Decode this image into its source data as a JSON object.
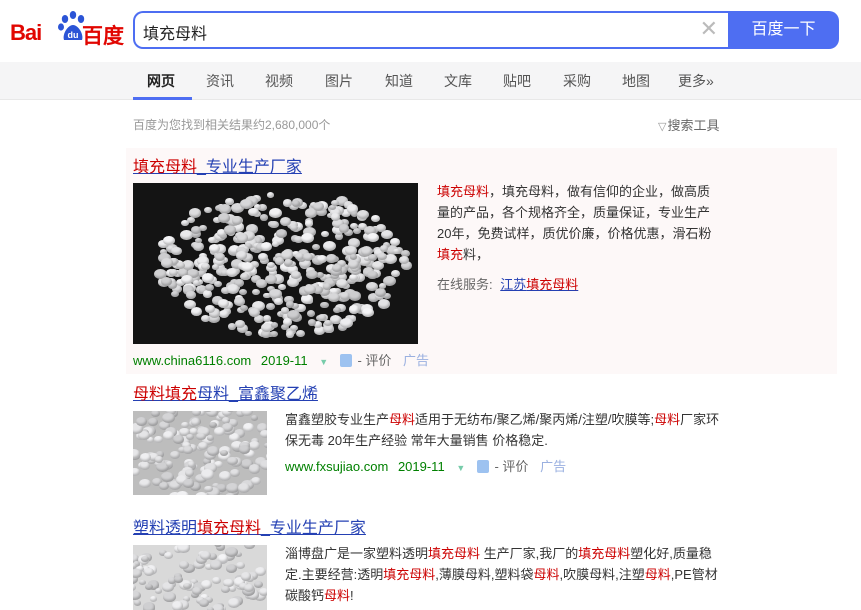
{
  "header": {
    "logo_bai": "Bai",
    "logo_du": "du",
    "logo_cn": "百度",
    "query": "填充母料",
    "clear_icon": "close-icon",
    "search_button": "百度一下"
  },
  "tabs": [
    {
      "label": "网页",
      "active": true
    },
    {
      "label": "资讯"
    },
    {
      "label": "视频"
    },
    {
      "label": "图片"
    },
    {
      "label": "知道"
    },
    {
      "label": "文库"
    },
    {
      "label": "贴吧"
    },
    {
      "label": "采购"
    },
    {
      "label": "地图"
    },
    {
      "label": "更多»"
    }
  ],
  "info": {
    "result_count": "百度为您找到相关结果约2,680,000个",
    "tools_label": "搜索工具",
    "tools_icon": "funnel-icon"
  },
  "results": [
    {
      "title_parts": [
        {
          "text": "填充母料",
          "hl": true
        },
        {
          "text": "_专业生产厂家",
          "hl": false
        }
      ],
      "desc_parts": [
        {
          "text": "填充母料",
          "hl": true
        },
        {
          "text": "，填充母料，做有信仰的企业，做高质量的产品，各个规格齐全，质量保证，专业生产20年，免费试样，质优价廉，价格优惠，滑石粉",
          "hl": false
        },
        {
          "text": "填充",
          "hl": true
        },
        {
          "text": "料，",
          "hl": false
        }
      ],
      "service_label": "在线服务:",
      "service_link_parts": [
        {
          "text": "江苏",
          "hl": false
        },
        {
          "text": "填充母料",
          "hl": true
        }
      ],
      "url": "www.china6116.com",
      "date": "2019-11",
      "rate_label": "- 评价",
      "ad_label": "广告"
    },
    {
      "title_parts": [
        {
          "text": "母料",
          "hl": true
        },
        {
          "text": "填充",
          "hl": true
        },
        {
          "text": "母料",
          "hl": false
        },
        {
          "text": "_富鑫聚乙烯",
          "hl": false
        }
      ],
      "desc_parts": [
        {
          "text": "富鑫塑胶专业生产",
          "hl": false
        },
        {
          "text": "母料",
          "hl": true
        },
        {
          "text": "适用于无纺布/聚乙烯/聚丙烯/注塑/吹膜等;",
          "hl": false
        },
        {
          "text": "母料",
          "hl": true
        },
        {
          "text": "厂家环保无毒 20年生产经验 常年大量销售 价格稳定.",
          "hl": false
        }
      ],
      "url": "www.fxsujiao.com",
      "date": "2019-11",
      "rate_label": "- 评价",
      "ad_label": "广告"
    },
    {
      "title_parts": [
        {
          "text": "塑料透明",
          "hl": false
        },
        {
          "text": "填充母料",
          "hl": true
        },
        {
          "text": "_专业生产厂家",
          "hl": false
        }
      ],
      "desc_parts": [
        {
          "text": "淄博盘广是一家塑料透明",
          "hl": false
        },
        {
          "text": "填充母料",
          "hl": true
        },
        {
          "text": " 生产厂家,我厂的",
          "hl": false
        },
        {
          "text": "填充母料",
          "hl": true
        },
        {
          "text": "塑化好,质量稳定.主要经营:透明",
          "hl": false
        },
        {
          "text": "填充母料",
          "hl": true
        },
        {
          "text": ",薄膜母料,塑料袋",
          "hl": false
        },
        {
          "text": "母料",
          "hl": true
        },
        {
          "text": ",吹膜母料,注塑",
          "hl": false
        },
        {
          "text": "母料",
          "hl": true
        },
        {
          "text": ",PE管材碳酸钙",
          "hl": false
        },
        {
          "text": "母料",
          "hl": true
        },
        {
          "text": "!",
          "hl": false
        }
      ]
    }
  ],
  "colors": {
    "accent": "#4e6ef2",
    "brand_red": "#e10601",
    "highlight": "#c00000",
    "link": "#2440b3",
    "url_green": "#008000"
  }
}
